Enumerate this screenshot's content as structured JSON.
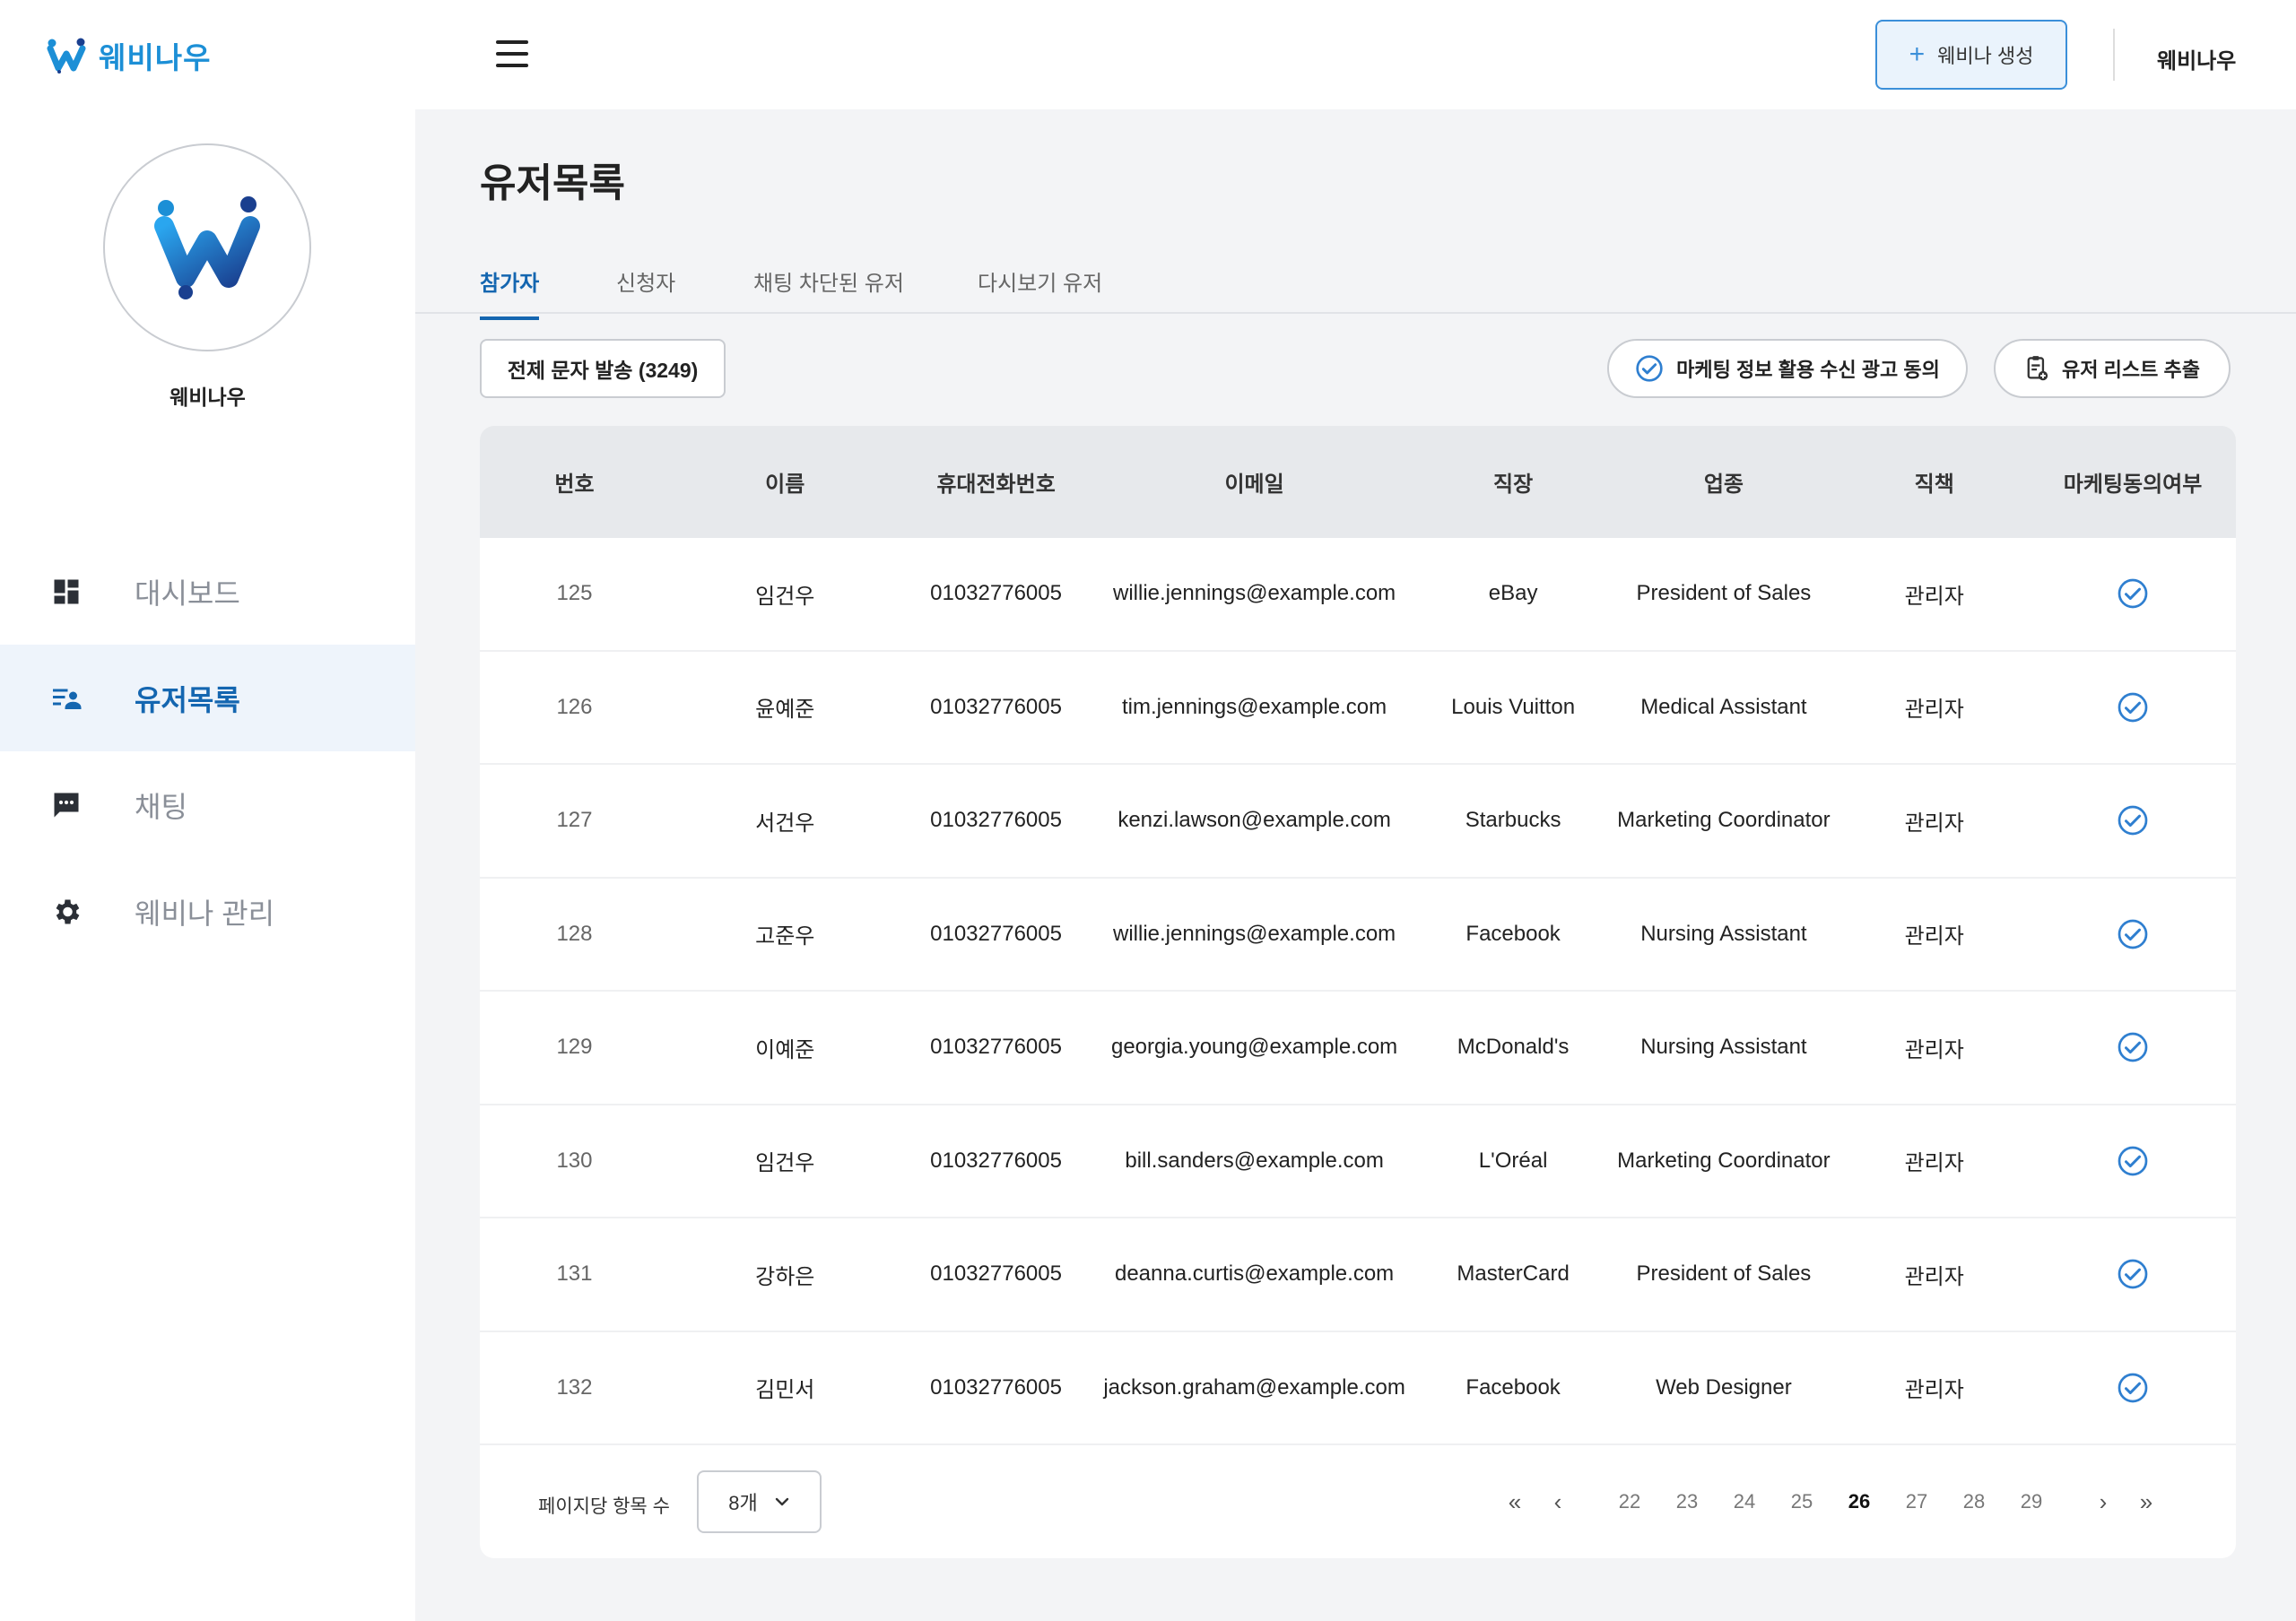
{
  "brand": {
    "name": "웨비나우"
  },
  "profile": {
    "name": "웨비나우"
  },
  "nav": [
    {
      "label": "대시보드",
      "icon": "dashboard-icon"
    },
    {
      "label": "유저목록",
      "icon": "user-list-icon",
      "active": true
    },
    {
      "label": "채팅",
      "icon": "chat-icon"
    },
    {
      "label": "웨비나 관리",
      "icon": "gear-icon"
    }
  ],
  "topbar": {
    "create_label": "웨비나 생성",
    "user_label": "웨비나우"
  },
  "page": {
    "title": "유저목록"
  },
  "tabs": [
    {
      "label": "참가자",
      "active": true
    },
    {
      "label": "신청자"
    },
    {
      "label": "채팅 차단된 유저"
    },
    {
      "label": "다시보기 유저"
    }
  ],
  "actions": {
    "send_all": "전제 문자 발송 (3249)",
    "marketing_consent": "마케팅 정보 활용 수신 광고 동의",
    "export_list": "유저 리스트 추출"
  },
  "table": {
    "headers": [
      "번호",
      "이름",
      "휴대전화번호",
      "이메일",
      "직장",
      "업종",
      "직책",
      "마케팅동의여부"
    ],
    "rows": [
      [
        "125",
        "임건우",
        "01032776005",
        "willie.jennings@example.com",
        "eBay",
        "President of Sales",
        "관리자"
      ],
      [
        "126",
        "윤예준",
        "01032776005",
        "tim.jennings@example.com",
        "Louis Vuitton",
        "Medical Assistant",
        "관리자"
      ],
      [
        "127",
        "서건우",
        "01032776005",
        "kenzi.lawson@example.com",
        "Starbucks",
        "Marketing Coordinator",
        "관리자"
      ],
      [
        "128",
        "고준우",
        "01032776005",
        "willie.jennings@example.com",
        "Facebook",
        "Nursing Assistant",
        "관리자"
      ],
      [
        "129",
        "이예준",
        "01032776005",
        "georgia.young@example.com",
        "McDonald's",
        "Nursing Assistant",
        "관리자"
      ],
      [
        "130",
        "임건우",
        "01032776005",
        "bill.sanders@example.com",
        "L'Oréal",
        "Marketing Coordinator",
        "관리자"
      ],
      [
        "131",
        "강하은",
        "01032776005",
        "deanna.curtis@example.com",
        "MasterCard",
        "President of Sales",
        "관리자"
      ],
      [
        "132",
        "김민서",
        "01032776005",
        "jackson.graham@example.com",
        "Facebook",
        "Web Designer",
        "관리자"
      ]
    ]
  },
  "pagination": {
    "per_page_label": "페이지당 항목 수",
    "per_page_value": "8개",
    "pages": [
      "22",
      "23",
      "24",
      "25",
      "26",
      "27",
      "28",
      "29"
    ],
    "current": "26"
  },
  "colors": {
    "accent": "#1466b0",
    "brand": "#1c8fd6",
    "check": "#2f7fd0"
  }
}
